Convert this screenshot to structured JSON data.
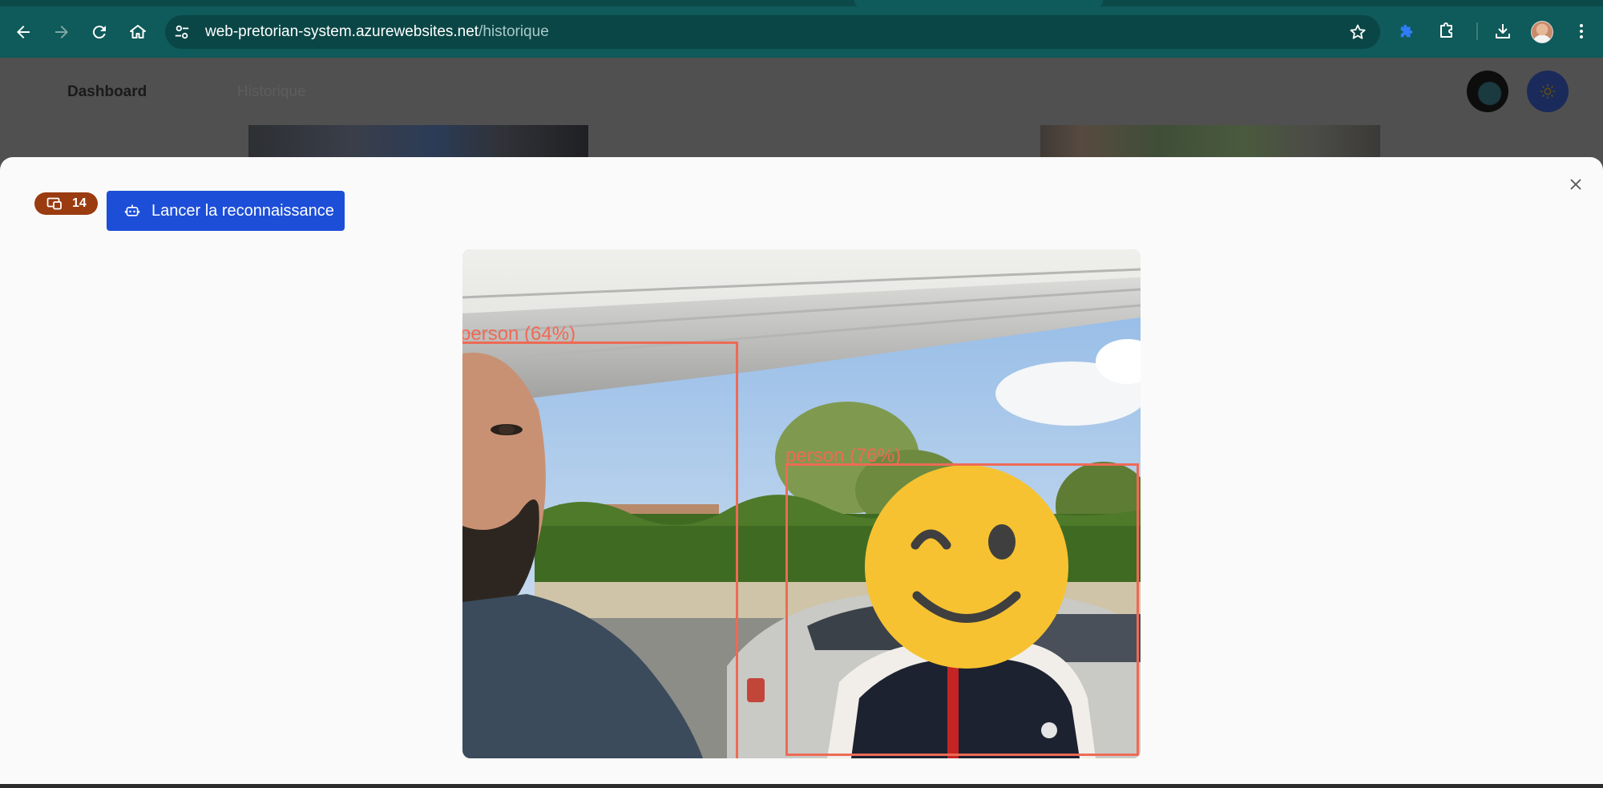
{
  "browser": {
    "url_host": "web-pretorian-system.azurewebsites.net",
    "url_path": "/historique",
    "accent": "#0f5a5a"
  },
  "app_nav": {
    "dashboard_label": "Dashboard",
    "historique_label": "Historique"
  },
  "modal": {
    "badge_count": "14",
    "launch_button_label": "Lancer la reconnaissance",
    "button_color": "#1d4ed8",
    "badge_color": "#9a3b10",
    "detections": [
      {
        "label": "person (64%)"
      },
      {
        "label": "person (76%)"
      }
    ]
  },
  "icons": [
    "back-arrow-icon",
    "forward-arrow-icon",
    "reload-icon",
    "home-icon",
    "site-settings-icon",
    "bookmark-star-icon",
    "extension-puzzle-icon",
    "extensions-icon",
    "download-icon",
    "kebab-menu-icon",
    "device-icon",
    "robot-icon",
    "close-icon",
    "winking-smiley-icon"
  ]
}
